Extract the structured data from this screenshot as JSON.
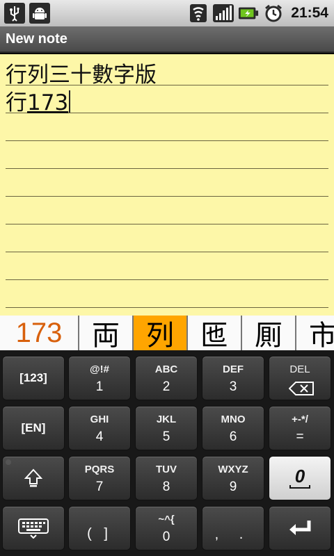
{
  "status_bar": {
    "time": "21:54",
    "icons_left": [
      "usb-icon",
      "android-debug-icon"
    ],
    "icons_right": [
      "wifi-icon",
      "signal-icon",
      "battery-charging-icon",
      "alarm-icon"
    ]
  },
  "title_bar": {
    "title": "New note"
  },
  "note": {
    "lines": [
      {
        "text": "行列三十數字版",
        "underlined": ""
      },
      {
        "text": "行",
        "underlined": "173"
      }
    ]
  },
  "candidates": {
    "items": [
      "173",
      "両",
      "列",
      "匜",
      "厠",
      "市"
    ],
    "selected_index": 2
  },
  "keyboard": {
    "rows": [
      [
        {
          "top": "",
          "main": "[123]"
        },
        {
          "top": "@!#",
          "main": "1"
        },
        {
          "top": "ABC",
          "main": "2"
        },
        {
          "top": "DEF",
          "main": "3"
        },
        {
          "top": "DEL",
          "main": ""
        }
      ],
      [
        {
          "top": "",
          "main": "[EN]"
        },
        {
          "top": "GHI",
          "main": "4"
        },
        {
          "top": "JKL",
          "main": "5"
        },
        {
          "top": "MNO",
          "main": "6"
        },
        {
          "top": "+-*/",
          "main": "="
        }
      ],
      [
        {
          "top": "",
          "main": ""
        },
        {
          "top": "PQRS",
          "main": "7"
        },
        {
          "top": "TUV",
          "main": "8"
        },
        {
          "top": "WXYZ",
          "main": "9"
        },
        {
          "top": "",
          "main": "0"
        }
      ],
      [
        {
          "top": "",
          "main": ""
        },
        {
          "top": "",
          "main": "( ]"
        },
        {
          "top": "~^{",
          "main": "0"
        },
        {
          "top": "",
          "main": ", ."
        },
        {
          "top": "",
          "main": ""
        }
      ]
    ]
  },
  "colors": {
    "note_background": "#fdf7a8",
    "candidate_highlight": "#ffa500",
    "candidate_number": "#d8600c"
  }
}
